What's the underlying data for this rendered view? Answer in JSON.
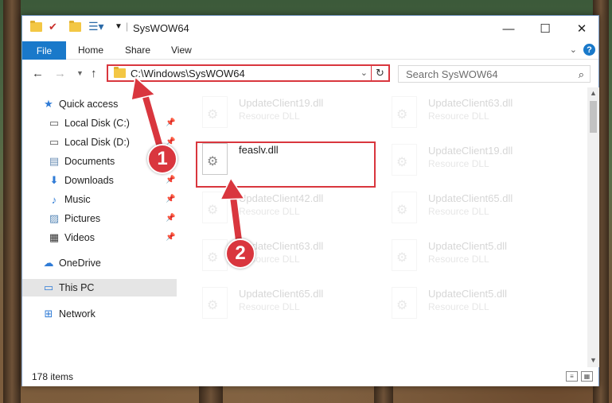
{
  "window": {
    "title": "SysWOW64"
  },
  "window_controls": {
    "minimize": "—",
    "maximize": "☐",
    "close": "✕"
  },
  "ribbon": {
    "tabs": [
      "File",
      "Home",
      "Share",
      "View"
    ],
    "help": "?"
  },
  "address_bar": {
    "path": "C:\\Windows\\SysWOW64"
  },
  "search": {
    "placeholder": "Search SysWOW64"
  },
  "sidebar": {
    "items": [
      {
        "label": "Quick access",
        "icon": "star-icon",
        "pinned": false
      },
      {
        "label": "Local Disk (C:)",
        "icon": "drive-icon",
        "pinned": true
      },
      {
        "label": "Local Disk (D:)",
        "icon": "drive-icon",
        "pinned": true
      },
      {
        "label": "Documents",
        "icon": "documents-icon",
        "pinned": false
      },
      {
        "label": "Downloads",
        "icon": "download-icon",
        "pinned": true
      },
      {
        "label": "Music",
        "icon": "music-icon",
        "pinned": true
      },
      {
        "label": "Pictures",
        "icon": "pictures-icon",
        "pinned": true
      },
      {
        "label": "Videos",
        "icon": "videos-icon",
        "pinned": true
      },
      {
        "label": "OneDrive",
        "icon": "cloud-icon",
        "pinned": false
      },
      {
        "label": "This PC",
        "icon": "computer-icon",
        "pinned": false,
        "selected": true
      },
      {
        "label": "Network",
        "icon": "network-icon",
        "pinned": false
      }
    ]
  },
  "files": {
    "highlighted": {
      "name": "feaslv.dll"
    },
    "left_column": [
      {
        "name": "UpdateClient19.dll",
        "type": "Resource DLL"
      },
      {
        "name": "UpdateClient42.dll",
        "type": "Resource DLL"
      },
      {
        "name": "UpdateClient63.dll",
        "type": "Resource DLL"
      },
      {
        "name": "UpdateClient65.dll",
        "type": "Resource DLL"
      }
    ],
    "right_column": [
      {
        "name": "UpdateClient63.dll",
        "type": "Resource DLL"
      },
      {
        "name": "UpdateClient19.dll",
        "type": "Resource DLL"
      },
      {
        "name": "UpdateClient65.dll",
        "type": "Resource DLL"
      },
      {
        "name": "UpdateClient5.dll",
        "type": "Resource DLL"
      },
      {
        "name": "UpdateClient5.dll",
        "type": "Resource DLL"
      }
    ]
  },
  "status": {
    "item_count": "178 items"
  },
  "annotations": {
    "step1": "1",
    "step2": "2",
    "color": "#d9363e"
  }
}
